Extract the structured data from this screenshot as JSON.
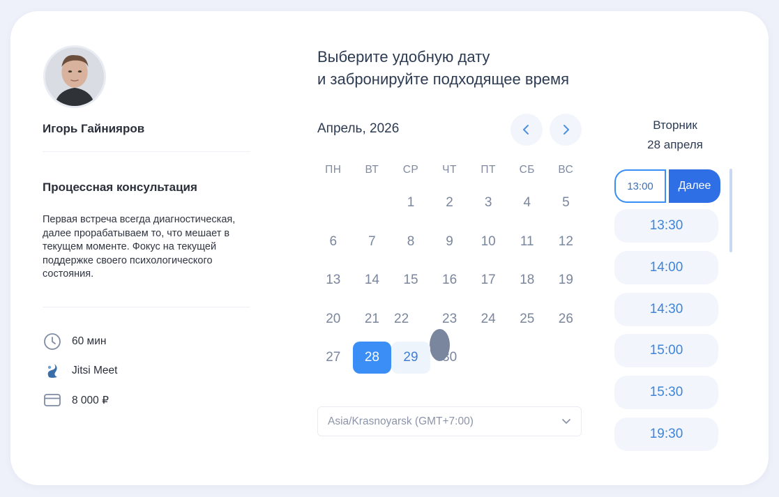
{
  "profile": {
    "name": "Игорь Гайнияров"
  },
  "service": {
    "title": "Процессная консультация",
    "description": "Первая встреча всегда диагностическая, далее прорабатываем то, что мешает в текущем моменте. Фокус на текущей поддержке своего психологического состояния.",
    "duration": "60 мин",
    "platform": "Jitsi Meet",
    "price": "8 000 ₽",
    "icons": [
      "clock-icon",
      "jitsi-logo-icon",
      "credit-card-icon"
    ]
  },
  "booking": {
    "heading_line1": "Выберите удобную дату",
    "heading_line2": "и забронируйте подходящее время",
    "month": "Апрель, 2026",
    "weekdays": [
      "ПН",
      "ВТ",
      "СР",
      "ЧТ",
      "ПТ",
      "СБ",
      "ВС"
    ],
    "weeks": [
      [
        "",
        "",
        "1",
        "2",
        "3",
        "4",
        "5"
      ],
      [
        "6",
        "7",
        "8",
        "9",
        "10",
        "11",
        "12"
      ],
      [
        "13",
        "14",
        "15",
        "16",
        "17",
        "18",
        "19"
      ],
      [
        "20",
        "21",
        "22",
        "23",
        "24",
        "25",
        "26"
      ],
      [
        "27",
        "28",
        "29",
        "30",
        "",
        "",
        ""
      ]
    ],
    "selected_day": "28",
    "available_next_day": "29",
    "today_marker_day": "22",
    "timezone": "Asia/Krasnoyarsk (GMT+7:00)",
    "accent_color": "#3b8ef5"
  },
  "slots": {
    "day_name": "Вторник",
    "day_date": "28 апреля",
    "selected_time": "13:00",
    "next_label": "Далее",
    "times": [
      "13:30",
      "14:00",
      "14:30",
      "15:00",
      "15:30",
      "19:30"
    ]
  }
}
